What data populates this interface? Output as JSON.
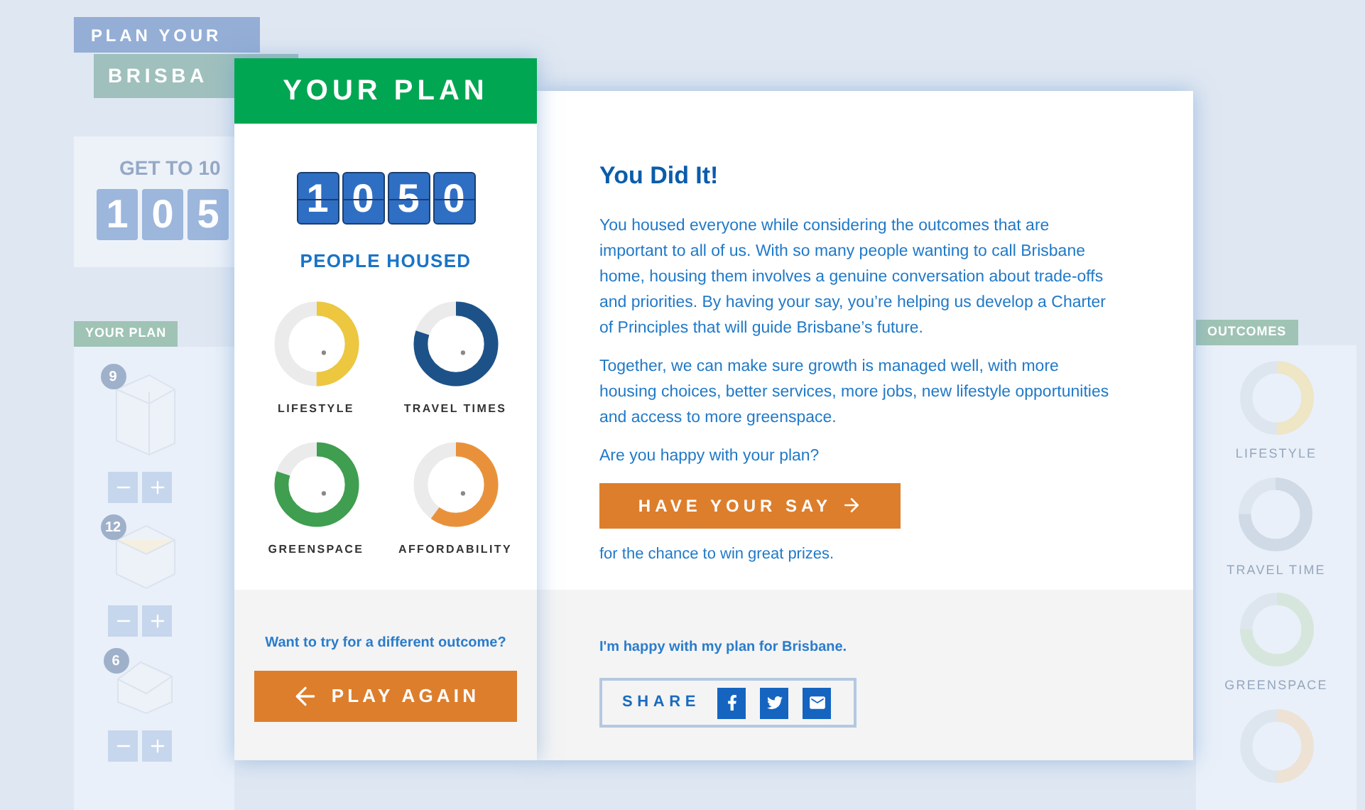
{
  "background": {
    "title_lines": [
      "PLAN YOUR",
      "BRISBA"
    ],
    "goal": {
      "label": "GET TO 10",
      "digits": [
        "1",
        "0",
        "5"
      ]
    },
    "plan_panel": {
      "tab": "YOUR PLAN",
      "buildings": [
        {
          "count": "9",
          "kind": "tower"
        },
        {
          "count": "12",
          "kind": "block"
        },
        {
          "count": "6",
          "kind": "house"
        }
      ]
    },
    "outcomes_panel": {
      "tab": "OUTCOMES",
      "items": [
        {
          "label": "LIFESTYLE",
          "level": 0.5,
          "color": "#eee6c4"
        },
        {
          "label": "TRAVEL TIME",
          "level": 0.75,
          "color": "#cfdae6"
        },
        {
          "label": "GREENSPACE",
          "level": 0.75,
          "color": "#d6e6dc"
        },
        {
          "level": 0.5,
          "color": "#ede2d4"
        }
      ]
    }
  },
  "plan_card": {
    "title": "YOUR PLAN",
    "counter": [
      "1",
      "0",
      "5",
      "0"
    ],
    "counter_label": "PEOPLE HOUSED",
    "outcomes": [
      {
        "label": "LIFESTYLE",
        "level": 0.5,
        "color": "#ecc73f"
      },
      {
        "label": "TRAVEL TIMES",
        "level": 0.8,
        "color": "#1d5288"
      },
      {
        "label": "GREENSPACE",
        "level": 0.8,
        "color": "#3f9e4f"
      },
      {
        "label": "AFFORDABILITY",
        "level": 0.6,
        "color": "#e9913a"
      }
    ],
    "prompt": "Want to try for a different outcome?",
    "button": "PLAY AGAIN"
  },
  "result": {
    "heading": "You Did It!",
    "paragraphs": [
      "You housed everyone while considering the outcomes that are important to all of us. With so many people wanting to call Brisbane home, housing them involves a genuine conversation about trade-offs and priorities. By having your say, you’re helping us develop a Charter of Principles that will guide Brisbane’s future.",
      "Together, we can make sure growth is managed well, with more housing choices, better services, more jobs, new lifestyle opportunities and access to more greenspace.",
      "Are you happy with your plan?"
    ],
    "button": "HAVE YOUR SAY",
    "note": "for the chance to win great prizes.",
    "share_text": "I'm happy with my plan for Brisbane.",
    "share_label": "SHARE",
    "share_buttons": [
      {
        "kind": "facebook"
      },
      {
        "kind": "twitter"
      },
      {
        "kind": "email"
      }
    ]
  }
}
